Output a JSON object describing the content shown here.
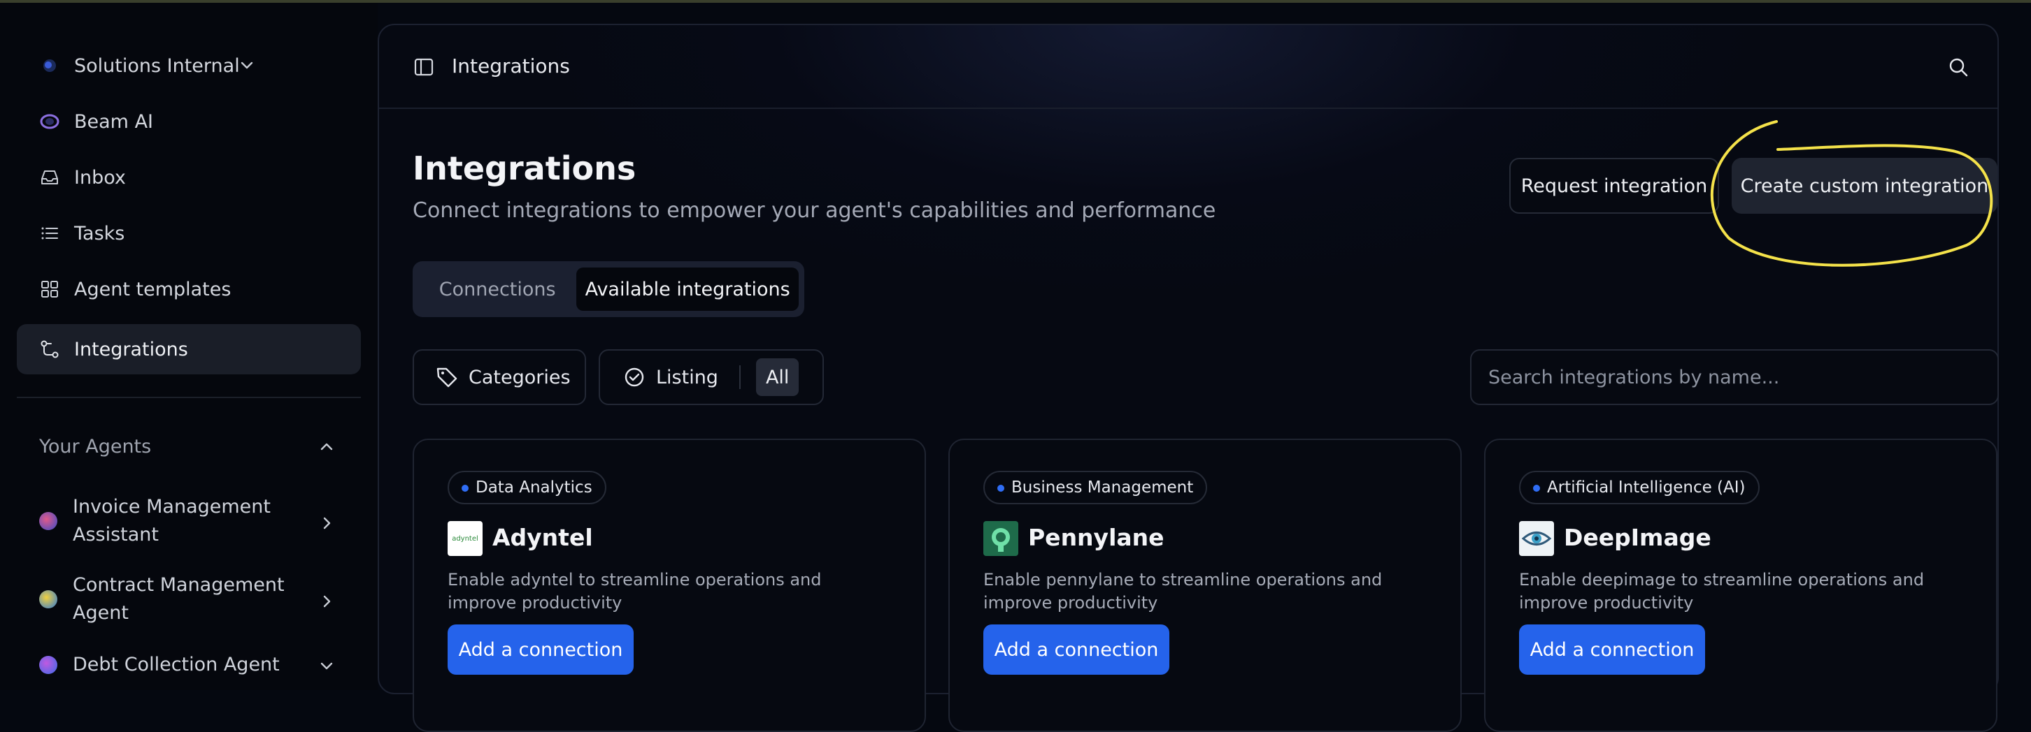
{
  "workspace": {
    "name": "Solutions Internal"
  },
  "nav": [
    {
      "label": "Beam AI",
      "icon": "beam-logo-icon"
    },
    {
      "label": "Inbox",
      "icon": "inbox-icon"
    },
    {
      "label": "Tasks",
      "icon": "list-icon"
    },
    {
      "label": "Agent templates",
      "icon": "grid-icon"
    },
    {
      "label": "Integrations",
      "icon": "integrations-icon",
      "active": true
    }
  ],
  "agents_section": {
    "title": "Your Agents",
    "items": [
      {
        "label": "Invoice Management Assistant"
      },
      {
        "label": "Contract Management Agent"
      },
      {
        "label": "Debt Collection Agent"
      }
    ]
  },
  "topbar": {
    "title": "Integrations"
  },
  "page": {
    "title": "Integrations",
    "subtitle": "Connect integrations to empower your agent's capabilities and performance"
  },
  "actions": {
    "request_label": "Request integration",
    "create_label": "Create custom integration"
  },
  "tabs": [
    {
      "label": "Connections",
      "active": false
    },
    {
      "label": "Available integrations",
      "active": true
    }
  ],
  "filters": {
    "categories_label": "Categories",
    "listing_label": "Listing",
    "listing_value": "All"
  },
  "search": {
    "placeholder": "Search integrations by name..."
  },
  "cards": [
    {
      "category": "Data Analytics",
      "name": "Adyntel",
      "logo_text": "adyntel",
      "description": "Enable adyntel to streamline operations and improve productivity",
      "button": "Add a connection"
    },
    {
      "category": "Business Management",
      "name": "Pennylane",
      "description": "Enable pennylane to streamline operations and improve productivity",
      "button": "Add a connection"
    },
    {
      "category": "Artificial Intelligence (AI)",
      "name": "DeepImage",
      "description": "Enable deepimage to streamline operations and improve productivity",
      "button": "Add a connection"
    }
  ],
  "colors": {
    "accent": "#2563eb",
    "annotation": "#f4e24a",
    "background": "#050810"
  }
}
